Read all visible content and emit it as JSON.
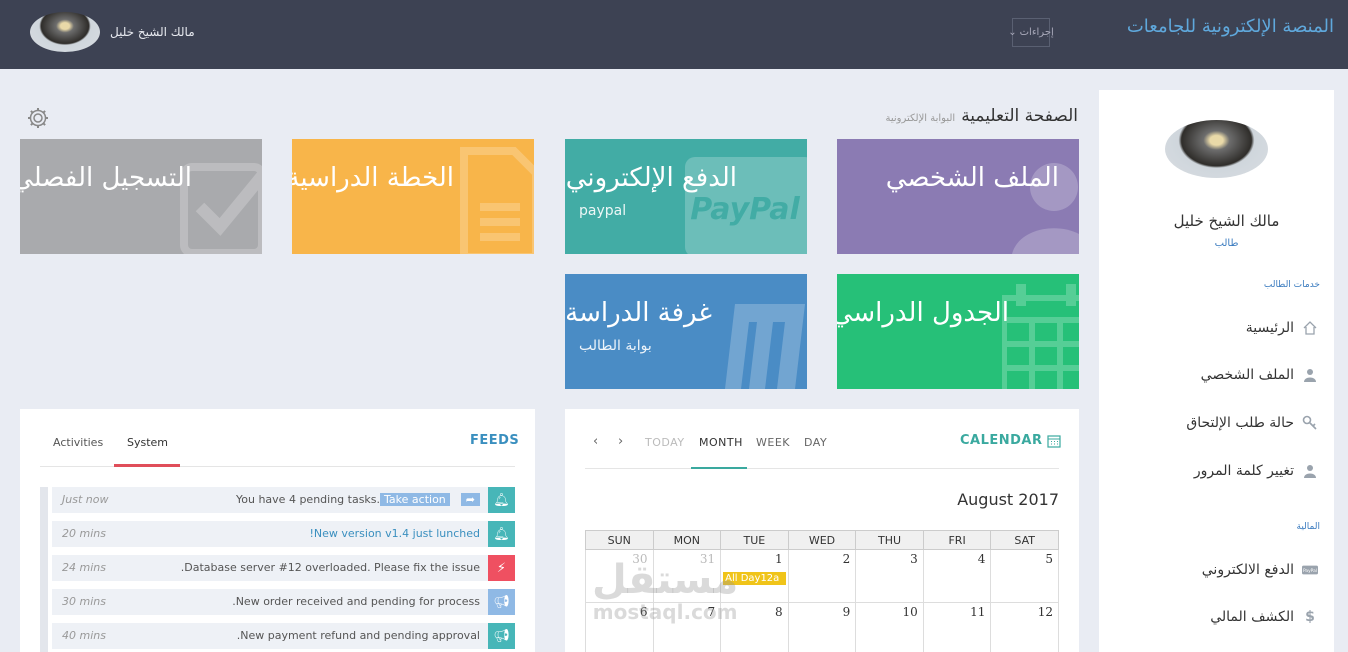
{
  "header": {
    "brand": "المنصة الإلكترونية للجامعات",
    "actions_label": "إجراءات",
    "user_name": "مالك الشيخ خليل"
  },
  "sidebar": {
    "name": "مالك الشيخ خليل",
    "role": "طالب",
    "section1": "خدمات الطالب",
    "items1": [
      {
        "label": "الرئيسية",
        "icon": "home-icon"
      },
      {
        "label": "الملف الشخصي",
        "icon": "user-icon"
      },
      {
        "label": "حالة طلب الإلتحاق",
        "icon": "key-icon"
      },
      {
        "label": "تغيير كلمة المرور",
        "icon": "user-icon"
      }
    ],
    "section2": "المالية",
    "items2": [
      {
        "label": "الدفع الالكتروني",
        "icon": "paypal-icon"
      },
      {
        "label": "الكشف المالي",
        "icon": "dollar-icon"
      }
    ]
  },
  "page": {
    "title": "الصفحة التعليمية",
    "subtitle": "البوابة الإلكترونية"
  },
  "tiles": [
    {
      "title": "الملف الشخصي",
      "sub": "",
      "color": "#8b7bb3",
      "icon": "user-icon"
    },
    {
      "title": "الدفع الإلكتروني",
      "sub": "paypal",
      "color": "#42aca5",
      "icon": "paypal-icon"
    },
    {
      "title": "الخطة الدراسية",
      "sub": "",
      "color": "#f8b54a",
      "icon": "document-icon"
    },
    {
      "title": "التسجيل الفصلي",
      "sub": "",
      "color": "#a9aaad",
      "icon": "checkmark-icon"
    },
    {
      "title": "الجدول الدراسي",
      "sub": "",
      "color": "#26c078",
      "icon": "calendar-icon"
    },
    {
      "title": "غرفة الدراسة",
      "sub": "بوابة الطالب",
      "color": "#4a8cc5",
      "icon": "moodle-icon"
    }
  ],
  "feeds": {
    "title": "FEEDS",
    "tabs": [
      "Activities",
      "System"
    ],
    "items": [
      {
        "text": "You have 4 pending tasks.",
        "action": "Take action",
        "time": "Just now",
        "color": "#47b6b8",
        "icon": "bell-icon"
      },
      {
        "text": "New version v1.4 just lunched!",
        "action": "",
        "time": "20 mins",
        "color": "#47b6b8",
        "icon": "bell-icon"
      },
      {
        "text": "Database server #12 overloaded. Please fix the issue.",
        "action": "",
        "time": "24 mins",
        "color": "#ef5061",
        "icon": "bolt-icon"
      },
      {
        "text": "New order received and pending for process.",
        "action": "",
        "time": "30 mins",
        "color": "#8fb9e5",
        "icon": "megaphone-icon"
      },
      {
        "text": "New payment refund and pending approval.",
        "action": "",
        "time": "40 mins",
        "color": "#47b6b8",
        "icon": "megaphone-icon"
      }
    ]
  },
  "calendar": {
    "title": "CALENDAR",
    "nav": [
      "TODAY",
      "MONTH",
      "WEEK",
      "DAY"
    ],
    "month": "August 2017",
    "days": [
      "SUN",
      "MON",
      "TUE",
      "WED",
      "THU",
      "FRI",
      "SAT"
    ],
    "weeks": [
      [
        "30",
        "31",
        "1",
        "2",
        "3",
        "4",
        "5"
      ],
      [
        "6",
        "7",
        "8",
        "9",
        "10",
        "11",
        "12"
      ]
    ],
    "event": "All Day12a"
  },
  "watermark": {
    "arabic": "مستقل",
    "latin": "mostaql.com"
  }
}
